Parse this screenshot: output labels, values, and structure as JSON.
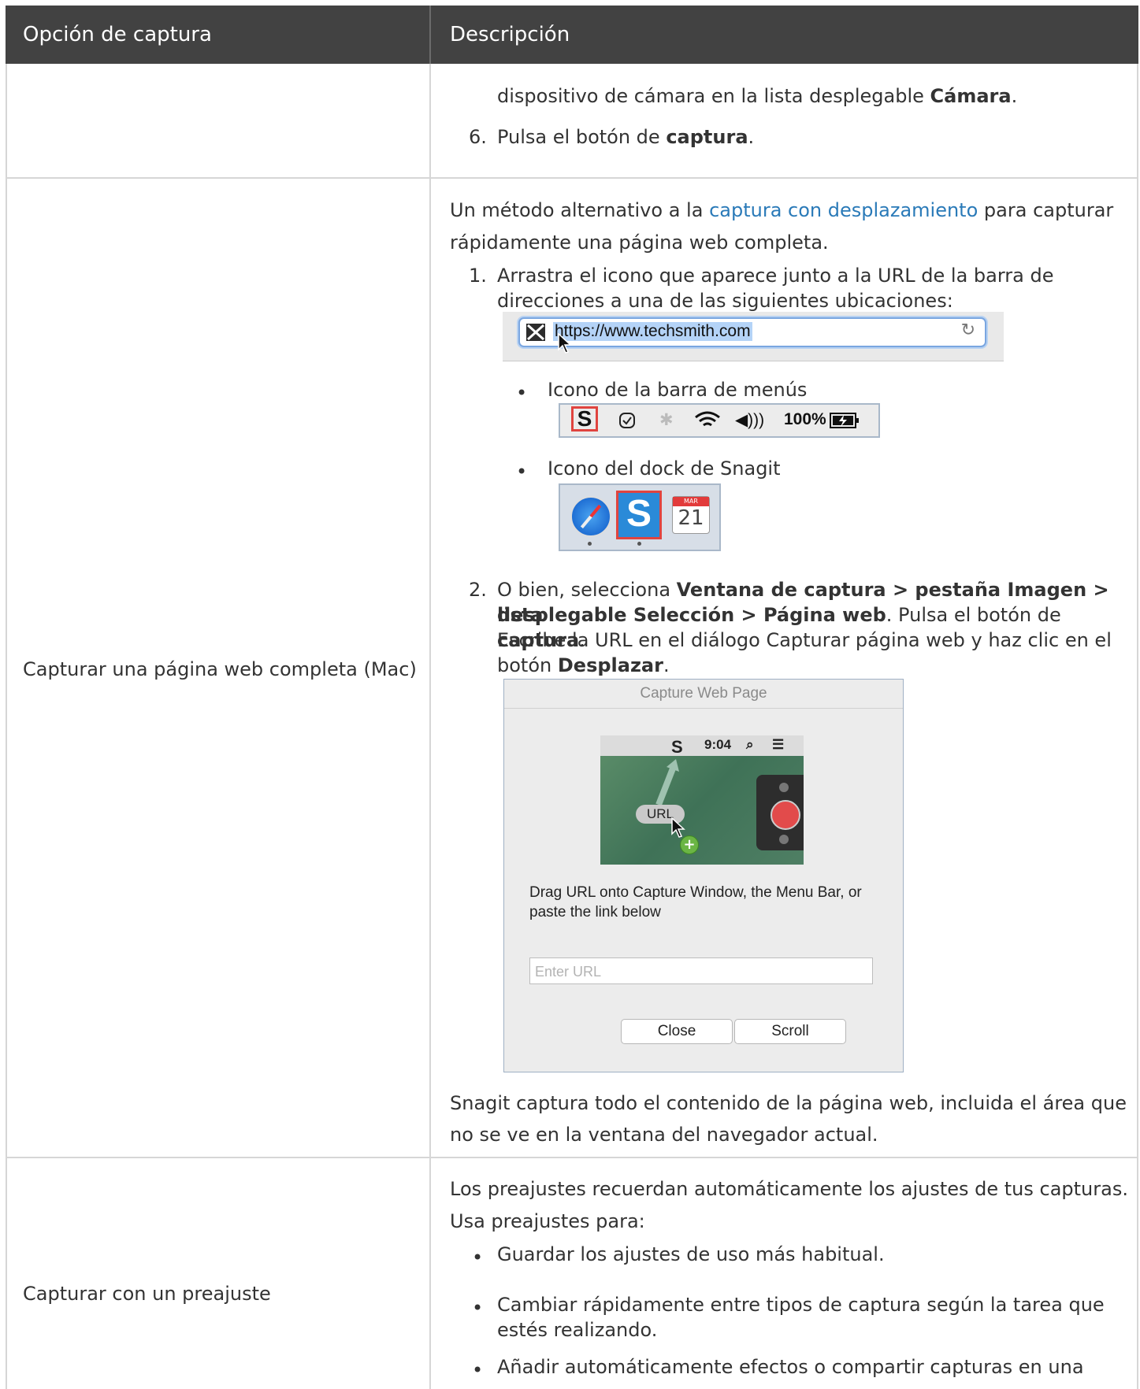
{
  "table": {
    "headers": [
      "Opción de captura",
      "Descripción"
    ]
  },
  "row1": {
    "continuation": "dispositivo de cámara en la lista desplegable",
    "continuation_bold": "Cámara",
    "step6_num": "6.",
    "step6_text": "Pulsa el botón de",
    "step6_bold": "captura"
  },
  "row2": {
    "label": "Capturar una página web completa (Mac)",
    "intro_pre": "Un método alternativo a la",
    "intro_link": "captura con desplazamiento",
    "intro_post": "para capturar",
    "intro_line2": "rápidamente una página web completa.",
    "step1_num": "1.",
    "step1_line1": "Arrastra el icono que aparece junto a la URL de la barra de",
    "step1_line2": "direcciones a una de las siguientes ubicaciones:",
    "url": "https://www.techsmith.com",
    "bullet1": "Icono de la barra de menús",
    "menubar_battery": "100%",
    "bullet2": "Icono del dock de Snagit",
    "dock_cal_month": "MAR",
    "dock_cal_day": "21",
    "step2_num": "2.",
    "step2_pre": "O bien, selecciona",
    "step2_bold1": "Ventana de captura > pestaña Imagen > lista",
    "step2_bold2": "desplegable Selección > Página web",
    "step2_mid": ". Pulsa el botón de",
    "step2_bold3": "captura",
    "step2_line3": "Escribe la URL en el diálogo Capturar página web y haz clic en el",
    "step2_line4_pre": "botón",
    "step2_bold4": "Desplazar",
    "dialog": {
      "title": "Capture Web Page",
      "time": "9:04",
      "pill": "URL",
      "text": "Drag URL onto Capture Window, the Menu Bar, or paste the link below",
      "placeholder": "Enter URL",
      "close": "Close",
      "scroll": "Scroll"
    },
    "outro_line1": "Snagit captura todo el contenido de la página web, incluida el área que",
    "outro_line2": "no se ve en la ventana del navegador actual."
  },
  "row3": {
    "label": "Capturar con un preajuste",
    "intro_line1": "Los preajustes recuerdan automáticamente los ajustes de tus capturas.",
    "intro_line2": "Usa preajustes para:",
    "b1": "Guardar los ajustes de uso más habitual.",
    "b2_line1": "Cambiar rápidamente entre tipos de captura según la tarea que",
    "b2_line2": "estés realizando.",
    "b3": "Añadir automáticamente efectos o compartir capturas en una"
  }
}
